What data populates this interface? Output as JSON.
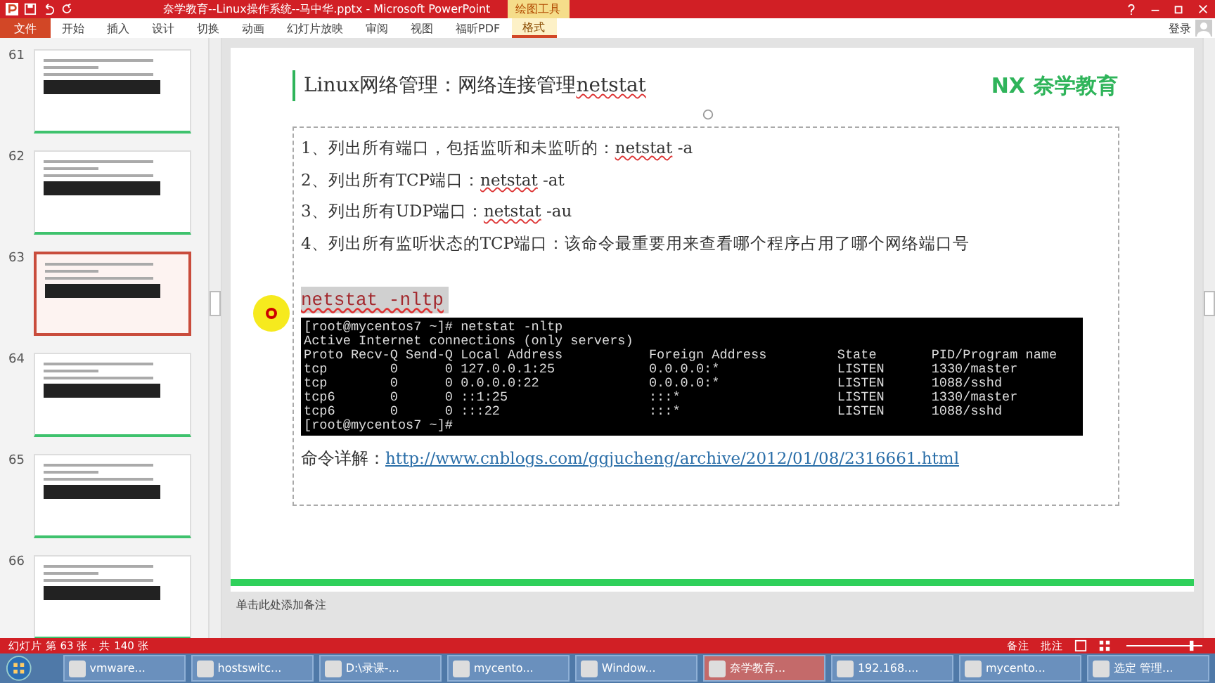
{
  "window": {
    "title": "奈学教育--Linux操作系统--马中华.pptx - Microsoft PowerPoint",
    "context_tab": "绘图工具"
  },
  "ribbon_tabs": [
    {
      "label": "文件",
      "kind": "file",
      "selected": false
    },
    {
      "label": "开始",
      "kind": "tab",
      "selected": false
    },
    {
      "label": "插入",
      "kind": "tab",
      "selected": false
    },
    {
      "label": "设计",
      "kind": "tab",
      "selected": false
    },
    {
      "label": "切换",
      "kind": "tab",
      "selected": false
    },
    {
      "label": "动画",
      "kind": "tab",
      "selected": false
    },
    {
      "label": "幻灯片放映",
      "kind": "tab",
      "selected": false
    },
    {
      "label": "审阅",
      "kind": "tab",
      "selected": false
    },
    {
      "label": "视图",
      "kind": "tab",
      "selected": false
    },
    {
      "label": "福昕PDF",
      "kind": "tab",
      "selected": false
    },
    {
      "label": "格式",
      "kind": "context",
      "selected": true
    }
  ],
  "account": {
    "label": "登录"
  },
  "thumbnails": [
    {
      "number": "61",
      "selected": false
    },
    {
      "number": "62",
      "selected": false
    },
    {
      "number": "63",
      "selected": true
    },
    {
      "number": "64",
      "selected": false
    },
    {
      "number": "65",
      "selected": false
    },
    {
      "number": "66",
      "selected": false
    }
  ],
  "slide": {
    "title": "Linux网络管理：网络连接管理",
    "title_command": "netstat",
    "logo_mark": "NX",
    "logo_text": "奈学教育",
    "items": [
      {
        "text": "1、列出所有端口，包括监听和未监听的：",
        "command": "netstat",
        "args": " -a"
      },
      {
        "text": "2、列出所有TCP端口：",
        "command": "netstat",
        "args": " -at"
      },
      {
        "text": "3、列出所有UDP端口：",
        "command": "netstat",
        "args": " -au"
      },
      {
        "text": "4、列出所有监听状态的TCP端口：该命令最重要用来查看哪个程序占用了哪个网络端口号"
      }
    ],
    "highlighted_command": "netstat -nltp",
    "terminal": [
      "[root@mycentos7 ~]# netstat -nltp",
      "Active Internet connections (only servers)",
      "Proto Recv-Q Send-Q Local Address           Foreign Address         State       PID/Program name",
      "tcp        0      0 127.0.0.1:25            0.0.0.0:*               LISTEN      1330/master",
      "tcp        0      0 0.0.0.0:22              0.0.0.0:*               LISTEN      1088/sshd",
      "tcp6       0      0 ::1:25                  :::*                    LISTEN      1330/master",
      "tcp6       0      0 :::22                   :::*                    LISTEN      1088/sshd",
      "[root@mycentos7 ~]#"
    ],
    "detail_label": "命令详解：",
    "detail_link": "http://www.cnblogs.com/ggjucheng/archive/2012/01/08/2316661.html"
  },
  "notes": {
    "placeholder": "单击此处添加备注"
  },
  "status_bar": {
    "slide_info": "幻灯片 第 63 张，共 140 张",
    "notes": "备注",
    "comments": "批注"
  },
  "taskbar": [
    {
      "label": "vmware...",
      "active": false
    },
    {
      "label": "hostswitc...",
      "active": false
    },
    {
      "label": "D:\\录课-...",
      "active": false
    },
    {
      "label": "mycento...",
      "active": false
    },
    {
      "label": "Window...",
      "active": false
    },
    {
      "label": "奈学教育...",
      "active": true
    },
    {
      "label": "192.168....",
      "active": false
    },
    {
      "label": "mycento...",
      "active": false
    },
    {
      "label": "选定 管理...",
      "active": false
    }
  ]
}
